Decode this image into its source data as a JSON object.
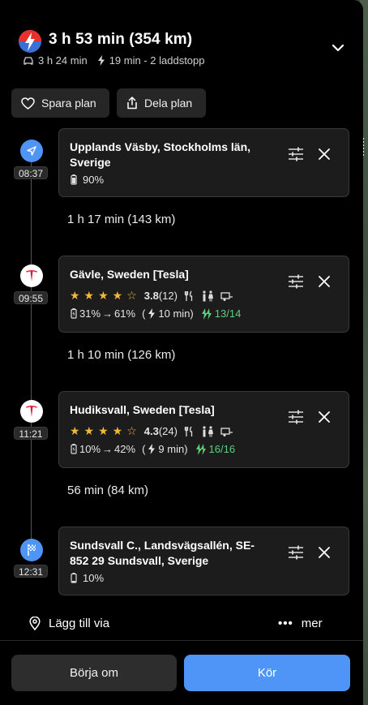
{
  "header": {
    "title": "3 h 53 min (354 km)",
    "drive_time": "3 h 24 min",
    "charge_summary": "19 min - 2 laddstopp"
  },
  "actions": {
    "save": "Spara plan",
    "share": "Dela plan"
  },
  "stops": [
    {
      "time": "08:37",
      "name": "Upplands Väsby, Stockholms län, Sverige",
      "battery": "90%",
      "icon": "navigation-arrow-icon"
    },
    {
      "time": "09:55",
      "name": "Gävle, Sweden [Tesla]",
      "rating": "3.8",
      "reviews": "(12)",
      "stars": "★★★★☆",
      "charge_from": "31%",
      "charge_to": "61%",
      "charge_time": "10 min)",
      "availability": "13/14",
      "icon": "tesla-logo-icon"
    },
    {
      "time": "11:21",
      "name": "Hudiksvall, Sweden [Tesla]",
      "rating": "4.3",
      "reviews": "(24)",
      "stars": "★★★★☆",
      "charge_from": "10%",
      "charge_to": "42%",
      "charge_time": "9 min)",
      "availability": "16/16",
      "icon": "tesla-logo-icon"
    },
    {
      "time": "12:31",
      "name": "Sundsvall C., Landsvägsallén, SE-852 29 Sundsvall, Sverige",
      "battery": "10%",
      "icon": "finish-flag-icon"
    }
  ],
  "legs": [
    "1 h 17 min (143 km)",
    "1 h 10 min (126 km)",
    "56 min (84 km)"
  ],
  "add_via": "Lägg till via",
  "more": "mer",
  "buttons": {
    "reset": "Börja om",
    "go": "Kör"
  },
  "colors": {
    "accent": "#4f95f7",
    "star": "#f2b73d",
    "available": "#5dcf7a",
    "tesla": "#e31937"
  }
}
